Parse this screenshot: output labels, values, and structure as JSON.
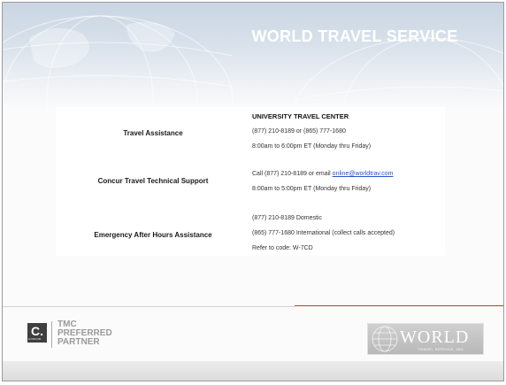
{
  "header": {
    "title": "WORLD TRAVEL SERVICE"
  },
  "rows": [
    {
      "label": "Travel Assistance",
      "lines": [
        "UNIVERSITY TRAVEL CENTER",
        "(877) 210-8189 or (865) 777-1680",
        "8:00am to 6:00pm ET (Monday thru Friday)"
      ]
    },
    {
      "label": "Concur Travel Technical Support",
      "line1_prefix": "Call (877) 210-8189 or email ",
      "email": "online@worldtrav.com",
      "line2": "8:00am to 5:00pm ET (Monday thru Friday)"
    },
    {
      "label": "Emergency After Hours Assistance",
      "lines": [
        "(877) 210-8189 Domestic",
        "(865) 777-1680 International (collect calls accepted)",
        "Refer to code: W-7CD"
      ]
    }
  ],
  "footer": {
    "concur_letter": "C.",
    "concur_word": "CONCUR",
    "tmc_lines": [
      "TMC",
      "PREFERRED",
      "PARTNER"
    ],
    "world_logo": "WORLD",
    "world_sub": "TRAVEL SERVICE, INC."
  },
  "colors": {
    "link": "#2a52c8",
    "accent_red": "#c0392b",
    "header_blue": "#c9d5e2"
  }
}
